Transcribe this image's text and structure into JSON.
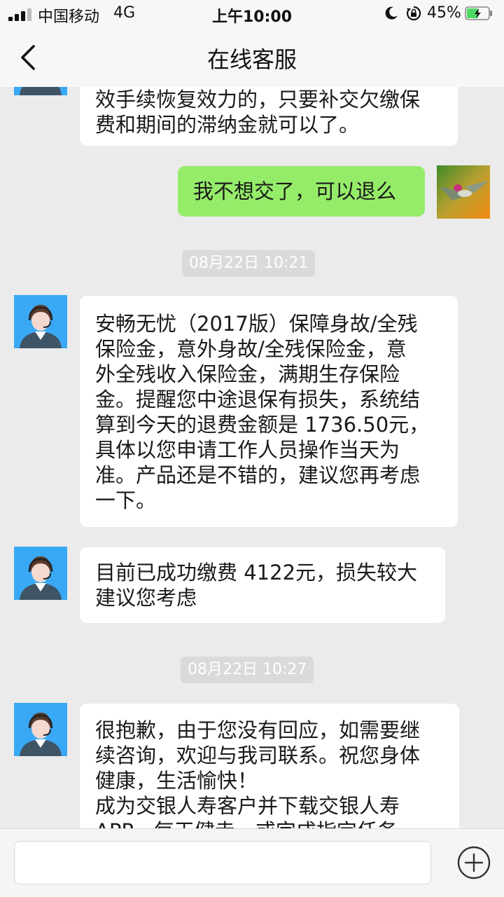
{
  "status_bar": {
    "carrier": "中国移动",
    "network": "4G",
    "time": "上午10:00",
    "battery": "45%"
  },
  "nav": {
    "title": "在线客服"
  },
  "messages": {
    "partial_agent": "效手续恢复效力的，只要补交欠缴保\n费和期间的滞纳金就可以了。",
    "user_msg": "我不想交了，可以退么",
    "ts1": "08月22日 10:21",
    "agent_msg1": "安畅无忧（2017版）保障身故/全残\n保险金，意外身故/全残保险金，意\n外全残收入保险金，满期生存保险\n金。提醒您中途退保有损失，系统结\n算到今天的退费金额是 1736.50元，\n具体以您申请工作人员操作当天为\n准。产品还是不错的，建议您再考虑\n一下。",
    "agent_msg2": "目前已成功缴费 4122元，损失较大\n建议您考虑",
    "ts2": "08月22日 10:27",
    "agent_msg3": "很抱歉，由于您没有回应，如需要继\n续咨询，欢迎与我司联系。祝您身体\n健康，生活愉快！\n成为交银人寿客户并下载交银人寿\nAPP，每天健走，或完成指定任务"
  },
  "input": {
    "value": "",
    "placeholder": ""
  },
  "icons": {
    "back": "back-arrow-icon",
    "plus": "plus-circle-icon",
    "agent_avatar": "customer-service-avatar",
    "user_avatar": "hummingbird-avatar"
  },
  "colors": {
    "user_bubble": "#95ec69",
    "agent_bubble": "#ffffff",
    "background": "#ebebeb"
  }
}
